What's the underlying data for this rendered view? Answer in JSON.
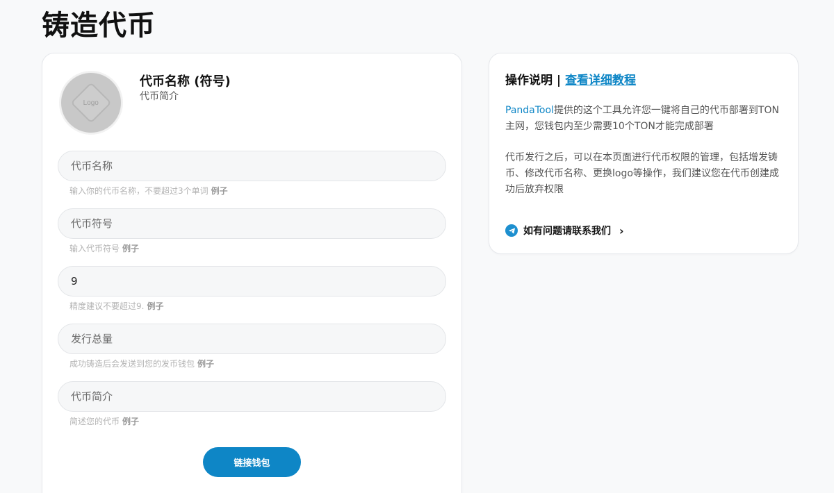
{
  "page": {
    "title": "铸造代币"
  },
  "preview": {
    "logo_text": "Logo",
    "token_name": "代币名称 (符号)",
    "token_desc": "代币简介"
  },
  "form": {
    "fields": [
      {
        "placeholder": "代币名称",
        "value": "",
        "hint": "输入你的代币名称，不要超过3个单词",
        "example": "例子"
      },
      {
        "placeholder": "代币符号",
        "value": "",
        "hint": "输入代币符号",
        "example": "例子"
      },
      {
        "placeholder": "",
        "value": "9",
        "hint": "精度建议不要超过9.",
        "example": "例子"
      },
      {
        "placeholder": "发行总量",
        "value": "",
        "hint": "成功铸造后会发送到您的发币钱包",
        "example": "例子"
      },
      {
        "placeholder": "代币简介",
        "value": "",
        "hint": "简述您的代币",
        "example": "例子"
      }
    ],
    "connect_label": "链接钱包"
  },
  "info": {
    "title": "操作说明",
    "separator": "|",
    "tutorial_link": "查看详细教程",
    "para1_brand": "PandaTool",
    "para1_rest": "提供的这个工具允许您一键将自己的代币部署到TON主网，您钱包内至少需要10个TON才能完成部署",
    "para2": "代币发行之后，可以在本页面进行代币权限的管理，包括增发铸币、修改代币名称、更换logo等操作，我们建议您在代币创建成功后放弃权限",
    "contact": "如有问题请联系我们"
  },
  "colors": {
    "accent": "#0e86c6",
    "background": "#f8f9fa"
  },
  "icons": {
    "telegram": "telegram-icon",
    "chevron": "chevron-right-icon"
  }
}
